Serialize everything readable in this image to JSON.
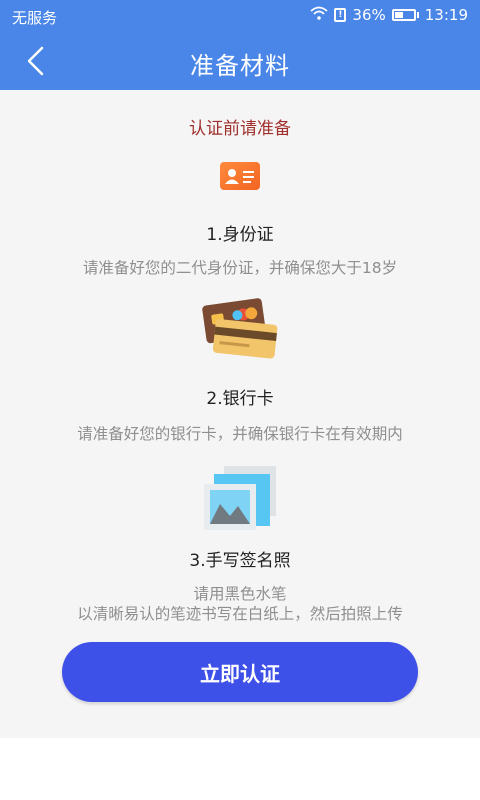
{
  "status_bar": {
    "carrier": "无服务",
    "battery": "36%",
    "time": "13:19"
  },
  "navbar": {
    "title": "准备材料",
    "back_icon": "chevron-left-icon"
  },
  "heading": "认证前请准备",
  "items": [
    {
      "icon": "id-card-icon",
      "title": "1.身份证",
      "desc": [
        "请准备好您的二代身份证，并确保您大于18岁"
      ]
    },
    {
      "icon": "bank-card-icon",
      "title": "2.银行卡",
      "desc": [
        "请准备好您的银行卡，并确保银行卡在有效期内"
      ]
    },
    {
      "icon": "photo-icon",
      "title": "3.手写签名照",
      "desc": [
        "请用黑色水笔",
        "以清晰易认的笔迹书写在白纸上，然后拍照上传"
      ]
    }
  ],
  "cta_label": "立即认证",
  "colors": {
    "primary": "#4a86e8",
    "button": "#3d50e8",
    "heading": "#a0302d"
  }
}
